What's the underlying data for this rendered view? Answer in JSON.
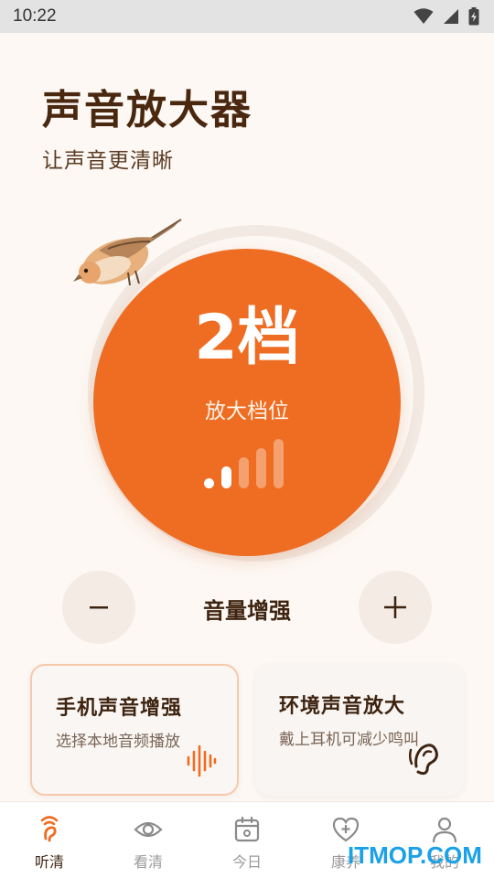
{
  "status_bar": {
    "time": "10:22"
  },
  "header": {
    "title": "声音放大器",
    "subtitle": "让声音更清晰"
  },
  "dial": {
    "level_text": "2档",
    "caption": "放大档位",
    "level": 2,
    "max_level": 5
  },
  "controls": {
    "decrease_symbol": "−",
    "increase_symbol": "+",
    "label": "音量增强"
  },
  "cards": [
    {
      "title": "手机声音增强",
      "description": "选择本地音频播放",
      "icon": "sound-wave-icon",
      "selected": true
    },
    {
      "title": "环境声音放大",
      "description": "戴上耳机可减少鸣叫",
      "icon": "ear-icon",
      "selected": false
    }
  ],
  "nav": {
    "items": [
      {
        "label": "听清",
        "icon": "hearing-icon",
        "active": true
      },
      {
        "label": "看清",
        "icon": "eye-icon",
        "active": false
      },
      {
        "label": "今日",
        "icon": "calendar-icon",
        "active": false
      },
      {
        "label": "康养",
        "icon": "heart-plus-icon",
        "active": false
      },
      {
        "label": "我的",
        "icon": "person-icon",
        "active": false
      }
    ]
  },
  "watermark": "ITMOP.COM",
  "colors": {
    "accent": "#ee6d22",
    "background": "#fdf8f4",
    "text_dark": "#4a2810"
  }
}
